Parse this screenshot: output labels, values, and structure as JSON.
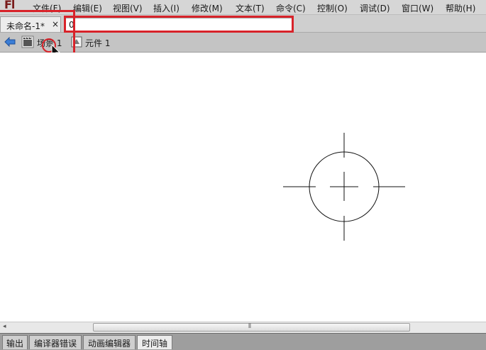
{
  "app": {
    "logo": "Fl"
  },
  "menubar": {
    "items": [
      {
        "label": "文件(F)"
      },
      {
        "label": "编辑(E)"
      },
      {
        "label": "视图(V)"
      },
      {
        "label": "插入(I)"
      },
      {
        "label": "修改(M)"
      },
      {
        "label": "文本(T)"
      },
      {
        "label": "命令(C)"
      },
      {
        "label": "控制(O)"
      },
      {
        "label": "调试(D)"
      },
      {
        "label": "窗口(W)"
      },
      {
        "label": "帮助(H)"
      }
    ]
  },
  "document_tabs": [
    {
      "label": "未命名-1*",
      "close": "×",
      "active": true
    },
    {
      "label": "0",
      "active": false
    }
  ],
  "editbar": {
    "back_icon": "arrow-left-icon",
    "scene": {
      "icon": "clapperboard-icon",
      "label": "场景 1"
    },
    "symbol": {
      "icon": "graphic-symbol-icon",
      "label": "元件 1"
    }
  },
  "annotation": {
    "color": "#d8232a"
  },
  "scrollbar": {
    "left_arrow": "◂",
    "grip": "⦀"
  },
  "panel_tabs": [
    {
      "label": "输出",
      "active": false
    },
    {
      "label": "编译器错误",
      "active": false
    },
    {
      "label": "动画编辑器",
      "active": false
    },
    {
      "label": "时间轴",
      "active": true
    }
  ]
}
